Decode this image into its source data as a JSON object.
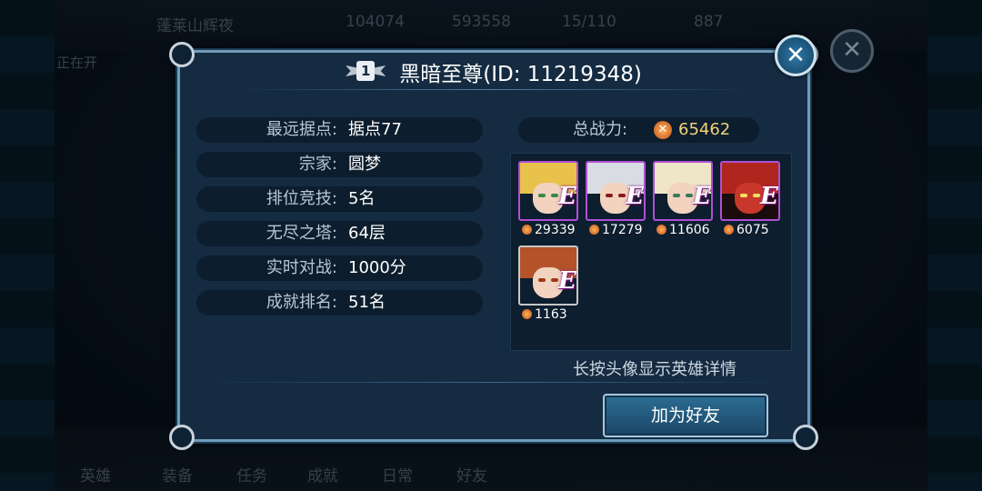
{
  "background": {
    "top_bar": {
      "player_name": "蓬莱山辉夜",
      "gold": "104074",
      "gems": "593558",
      "stamina": "15/110",
      "diamonds": "887",
      "left_label": "正在开"
    },
    "bottom_nav": [
      "英雄",
      "装备",
      "任务",
      "成就",
      "日常",
      "好友"
    ]
  },
  "dialog": {
    "rank": "1",
    "title": "黑暗至尊(ID: 11219348)",
    "stats": [
      {
        "label": "最远据点:",
        "value": "据点77"
      },
      {
        "label": "宗家:",
        "value": "圆梦"
      },
      {
        "label": "排位竞技:",
        "value": "5名"
      },
      {
        "label": "无尽之塔:",
        "value": "64层"
      },
      {
        "label": "实时对战:",
        "value": "1000分"
      },
      {
        "label": "成就排名:",
        "value": "51名"
      }
    ],
    "total_power_label": "总战力:",
    "total_power_value": "65462",
    "heroes": [
      {
        "grade": "E",
        "power": "29339",
        "hair": "#e8c24a",
        "frame": "purple"
      },
      {
        "grade": "E",
        "power": "17279",
        "hair": "#d9dde3",
        "frame": "purple"
      },
      {
        "grade": "E",
        "power": "11606",
        "hair": "#efe6c8",
        "frame": "purple"
      },
      {
        "grade": "E",
        "power": "6075",
        "hair": "#b0261e",
        "frame": "purple"
      },
      {
        "grade": "E",
        "power": "1163",
        "hair": "#b4522a",
        "frame": "silver"
      }
    ],
    "hint": "长按头像显示英雄详情",
    "add_friend_label": "加为好友",
    "close_symbol": "✕"
  },
  "colors": {
    "accent_gold": "#f4d27a",
    "epic_frame": "#b04fd6",
    "button": "#2c6d93"
  }
}
